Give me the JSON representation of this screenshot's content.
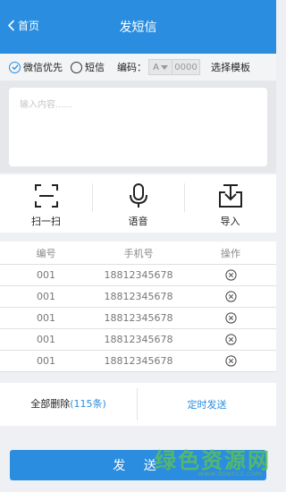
{
  "header": {
    "back_label": "首页",
    "title": "发短信"
  },
  "options": {
    "wechat_label": "微信优先",
    "sms_label": "短信",
    "code_label": "编码：",
    "code_select_value": "A",
    "code_input_placeholder": "0000",
    "template_label": "选择模板"
  },
  "message": {
    "placeholder": "输入内容......"
  },
  "tools": [
    {
      "label": "扫一扫",
      "icon": "scan-icon"
    },
    {
      "label": "语音",
      "icon": "microphone-icon"
    },
    {
      "label": "导入",
      "icon": "import-icon"
    }
  ],
  "table": {
    "headers": [
      "编号",
      "手机号",
      "操作"
    ],
    "rows": [
      {
        "id": "001",
        "phone": "18812345678"
      },
      {
        "id": "001",
        "phone": "18812345678"
      },
      {
        "id": "001",
        "phone": "18812345678"
      },
      {
        "id": "001",
        "phone": "18812345678"
      },
      {
        "id": "001",
        "phone": "18812345678"
      }
    ]
  },
  "bottom": {
    "delete_all_label": "全部删除",
    "count_label": "(115条)",
    "schedule_label": "定时发送"
  },
  "send_label": "发 送",
  "watermark": {
    "text": "绿色资源网",
    "url": "www.downcc.com"
  },
  "colors": {
    "primary": "#2a8ddf",
    "background": "#eef0f3"
  }
}
